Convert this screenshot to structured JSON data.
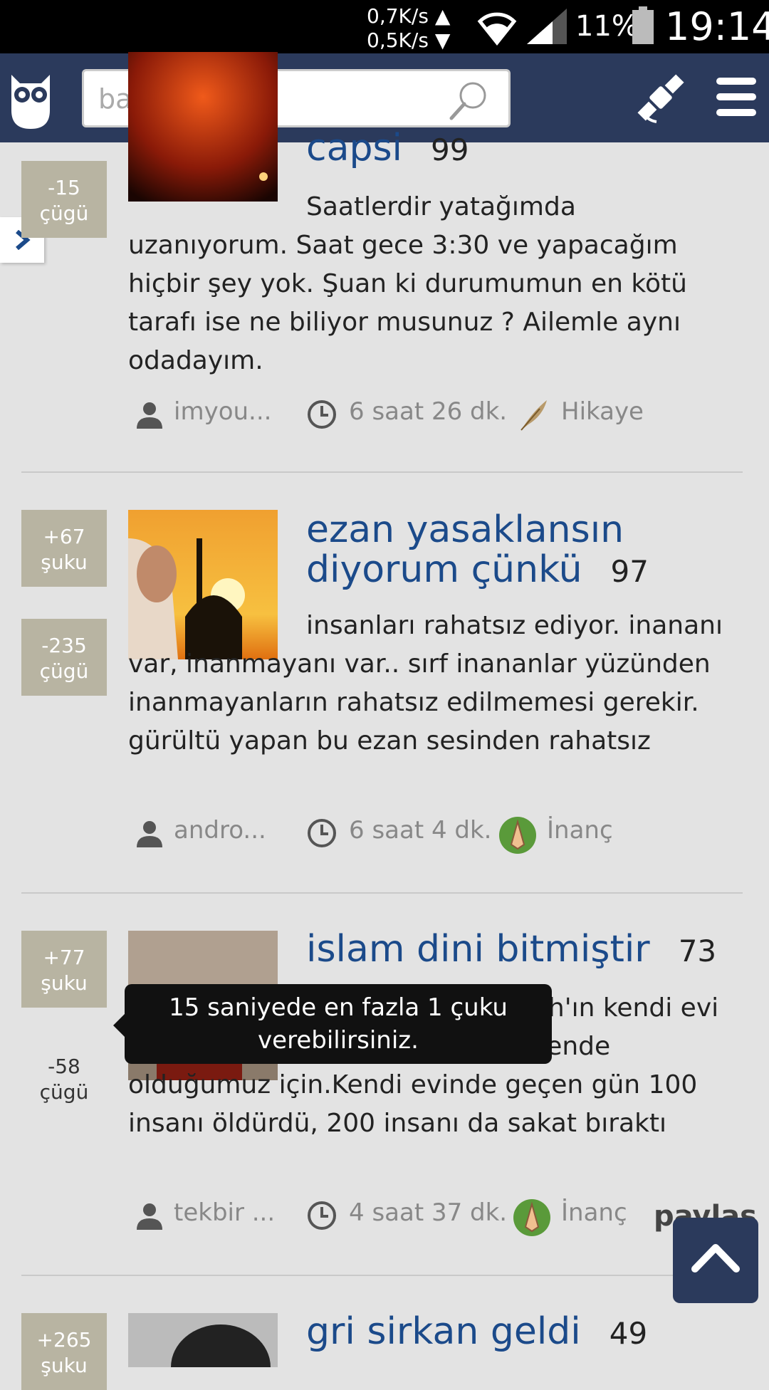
{
  "status_bar": {
    "net_up": "0,7K/s ▲",
    "net_down": "0,5K/s ▼",
    "battery": "11%",
    "time": "19:14"
  },
  "header": {
    "search_placeholder": "başlık"
  },
  "entries": [
    {
      "title": "capsi",
      "count": "99",
      "votes": [
        {
          "value": "-15",
          "label": "çügü"
        }
      ],
      "body": "Saatlerdir yatağımda uzanıyorum. Saat gece 3:30 ve yapacağım hiçbir şey yok. Şuan ki durumumun en kötü tarafı ise ne biliyor musunuz ? Ailemle aynı odadayım.",
      "author": "imyou...",
      "time": "6 saat 26 dk.",
      "category": "Hikaye"
    },
    {
      "title": "ezan yasaklansın diyorum çünkü",
      "count": "97",
      "votes": [
        {
          "value": "+67",
          "label": "şuku"
        },
        {
          "value": "-235",
          "label": "çügü"
        }
      ],
      "body": "insanları rahatsız ediyor. inananı var, inanmayanı var.. sırf inananlar yüzünden inanmayanların rahatsız edilmemesi gerekir. gürültü yapan bu ezan sesinden rahatsız",
      "author": "andro...",
      "time": "6 saat 4 dk.",
      "category": "İnanç"
    },
    {
      "title": "islam dini bitmiştir",
      "count": "73",
      "votes": [
        {
          "value": "+77",
          "label": "şuku"
        },
        {
          "value": "-58",
          "label": "çügü"
        }
      ],
      "body": "Dinya da Kabe Allah'ın kendi evi değil mi?Ayetler de var orda güvende olduğumuz için.Kendi evinde geçen gün 100 insanı öldürdü, 200 insanı da sakat bıraktı",
      "author": "tekbir ...",
      "time": "4 saat 37 dk.",
      "category": "İnanç",
      "share": "paylaş"
    },
    {
      "title": "gri sirkan geldi",
      "count": "49",
      "votes": [
        {
          "value": "+265",
          "label": "şuku"
        }
      ]
    }
  ],
  "tooltip": {
    "line1": "15 saniyede en fazla 1 çuku",
    "line2": "verebilirsiniz."
  },
  "colors": {
    "header": "#2b3a5c",
    "title": "#1b4a8a",
    "vote_box": "#b8b4a2",
    "background": "#e3e3e3"
  }
}
